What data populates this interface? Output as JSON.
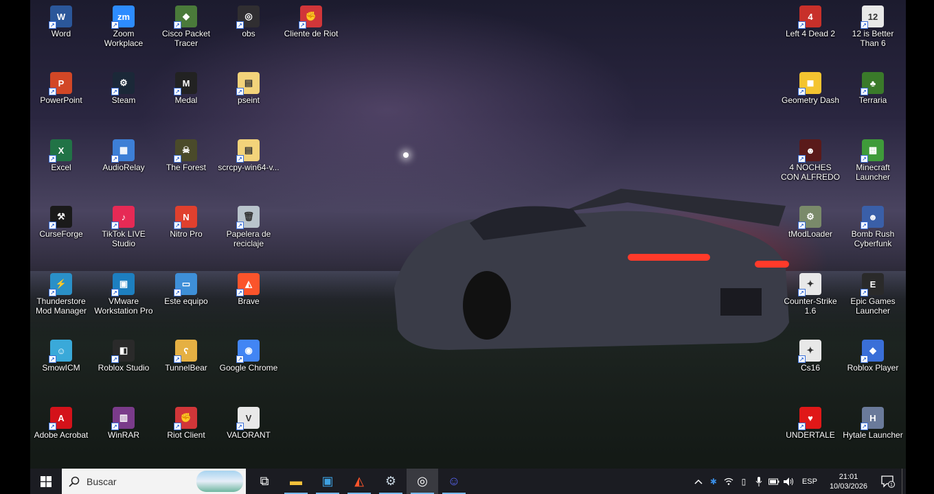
{
  "desktop": {
    "icons": [
      {
        "label": "Word",
        "icon": "word-icon",
        "color": "#2b579a",
        "glyph": "W"
      },
      {
        "label": "Zoom Workplace",
        "icon": "zoom-icon",
        "color": "#2d8cff",
        "glyph": "zm"
      },
      {
        "label": "Cisco Packet Tracer",
        "icon": "cisco-packet-tracer-icon",
        "color": "#4a7a3a",
        "glyph": "◆"
      },
      {
        "label": "obs",
        "icon": "obs-icon",
        "color": "#302e31",
        "glyph": "◎"
      },
      {
        "label": "Cliente de Riot",
        "icon": "riot-icon",
        "color": "#d13639",
        "glyph": "✊"
      },
      {
        "label": "PowerPoint",
        "icon": "powerpoint-icon",
        "color": "#d24726",
        "glyph": "P"
      },
      {
        "label": "Steam",
        "icon": "steam-icon",
        "color": "#1b2838",
        "glyph": "⚙"
      },
      {
        "label": "Medal",
        "icon": "medal-icon",
        "color": "#222222",
        "glyph": "M"
      },
      {
        "label": "pseint",
        "icon": "folder-icon",
        "color": "#f3d37a",
        "glyph": "▤"
      },
      {
        "label": "Excel",
        "icon": "excel-icon",
        "color": "#217346",
        "glyph": "X"
      },
      {
        "label": "AudioRelay",
        "icon": "audiorelay-icon",
        "color": "#3d7fd6",
        "glyph": "▦"
      },
      {
        "label": "The Forest",
        "icon": "the-forest-icon",
        "color": "#4a4a2a",
        "glyph": "☠"
      },
      {
        "label": "scrcpy-win64-v...",
        "icon": "folder-icon",
        "color": "#f3d37a",
        "glyph": "▤"
      },
      {
        "label": "CurseForge",
        "icon": "curseforge-icon",
        "color": "#1a1a1a",
        "glyph": "⚒"
      },
      {
        "label": "TikTok LIVE Studio",
        "icon": "tiktok-live-icon",
        "color": "#e62a55",
        "glyph": "♪"
      },
      {
        "label": "Nitro Pro",
        "icon": "nitro-pro-icon",
        "color": "#e0402e",
        "glyph": "N"
      },
      {
        "label": "Papelera de reciclaje",
        "icon": "recycle-bin-icon",
        "color": "#b9c4cc",
        "glyph": "🗑"
      },
      {
        "label": "Thunderstore Mod Manager",
        "icon": "thunderstore-icon",
        "color": "#2a90c8",
        "glyph": "⚡"
      },
      {
        "label": "VMware Workstation Pro",
        "icon": "vmware-icon",
        "color": "#1d7fc0",
        "glyph": "▣"
      },
      {
        "label": "Este equipo",
        "icon": "this-pc-icon",
        "color": "#3e8fd8",
        "glyph": "▭"
      },
      {
        "label": "Brave",
        "icon": "brave-icon",
        "color": "#fb542b",
        "glyph": "◭"
      },
      {
        "label": "SmowICM",
        "icon": "smowicm-icon",
        "color": "#3aa9d9",
        "glyph": "☺"
      },
      {
        "label": "Roblox Studio",
        "icon": "roblox-studio-icon",
        "color": "#2a2a2a",
        "glyph": "◧"
      },
      {
        "label": "TunnelBear",
        "icon": "tunnelbear-icon",
        "color": "#e5b043",
        "glyph": "ʕ"
      },
      {
        "label": "Google Chrome",
        "icon": "chrome-icon",
        "color": "#4285f4",
        "glyph": "◉"
      },
      {
        "label": "Adobe Acrobat",
        "icon": "acrobat-icon",
        "color": "#d4121a",
        "glyph": "A"
      },
      {
        "label": "WinRAR",
        "icon": "winrar-icon",
        "color": "#7a3b8a",
        "glyph": "▥"
      },
      {
        "label": "Riot Client",
        "icon": "riot-icon",
        "color": "#d13639",
        "glyph": "✊"
      },
      {
        "label": "VALORANT",
        "icon": "valorant-icon",
        "color": "#e8e8e8",
        "glyph": "V"
      },
      {
        "label": "Left 4 Dead 2",
        "icon": "left4dead2-icon",
        "color": "#c8302a",
        "glyph": "4"
      },
      {
        "label": "12 is Better Than 6",
        "icon": "12-is-better-than-6-icon",
        "color": "#e8e8e8",
        "glyph": "12"
      },
      {
        "label": "Geometry Dash",
        "icon": "geometry-dash-icon",
        "color": "#f4c430",
        "glyph": "◼"
      },
      {
        "label": "Terraria",
        "icon": "terraria-icon",
        "color": "#3a7a2a",
        "glyph": "♣"
      },
      {
        "label": "4 NOCHES CON ALFREDO",
        "icon": "4-noches-con-alfredo-icon",
        "color": "#5a1a1a",
        "glyph": "☻"
      },
      {
        "label": "Minecraft Launcher",
        "icon": "minecraft-icon",
        "color": "#3f9b3a",
        "glyph": "▩"
      },
      {
        "label": "tModLoader",
        "icon": "tmodloader-icon",
        "color": "#7a8a6a",
        "glyph": "⚙"
      },
      {
        "label": "Bomb Rush Cyberfunk",
        "icon": "bomb-rush-cyberfunk-icon",
        "color": "#3a5fa8",
        "glyph": "☻"
      },
      {
        "label": "Counter-Strike 1.6",
        "icon": "counter-strike-icon",
        "color": "#e8e8e8",
        "glyph": "✦"
      },
      {
        "label": "Epic Games Launcher",
        "icon": "epic-games-icon",
        "color": "#2a2a2a",
        "glyph": "E"
      },
      {
        "label": "Cs16",
        "icon": "counter-strike-icon",
        "color": "#e8e8e8",
        "glyph": "✦"
      },
      {
        "label": "Roblox Player",
        "icon": "roblox-icon",
        "color": "#3a6fd8",
        "glyph": "◆"
      },
      {
        "label": "UNDERTALE",
        "icon": "undertale-icon",
        "color": "#e01818",
        "glyph": "♥"
      },
      {
        "label": "Hytale Launcher",
        "icon": "hytale-icon",
        "color": "#6a7a9a",
        "glyph": "H"
      }
    ]
  },
  "taskbar": {
    "search_placeholder": "Buscar",
    "pinned": [
      {
        "name": "task-view-button",
        "icon": "task-view-icon",
        "glyph": "⧉",
        "color": "#ffffff"
      },
      {
        "name": "file-explorer-button",
        "icon": "folder-icon",
        "glyph": "▬",
        "color": "#f3c13a"
      },
      {
        "name": "remote-desktop-button",
        "icon": "remote-desktop-icon",
        "glyph": "▣",
        "color": "#3ea0e0"
      },
      {
        "name": "brave-button",
        "icon": "brave-icon",
        "glyph": "◭",
        "color": "#fb542b"
      },
      {
        "name": "steam-button",
        "icon": "steam-icon",
        "glyph": "⚙",
        "color": "#c7d5e0"
      },
      {
        "name": "obs-button",
        "icon": "obs-icon",
        "glyph": "◎",
        "color": "#ffffff"
      },
      {
        "name": "discord-button",
        "icon": "discord-icon",
        "glyph": "☺",
        "color": "#5865f2"
      }
    ],
    "tray": {
      "language": "ESP",
      "time": "21:01",
      "date": "10/03/2026",
      "notification_count": "1"
    }
  }
}
